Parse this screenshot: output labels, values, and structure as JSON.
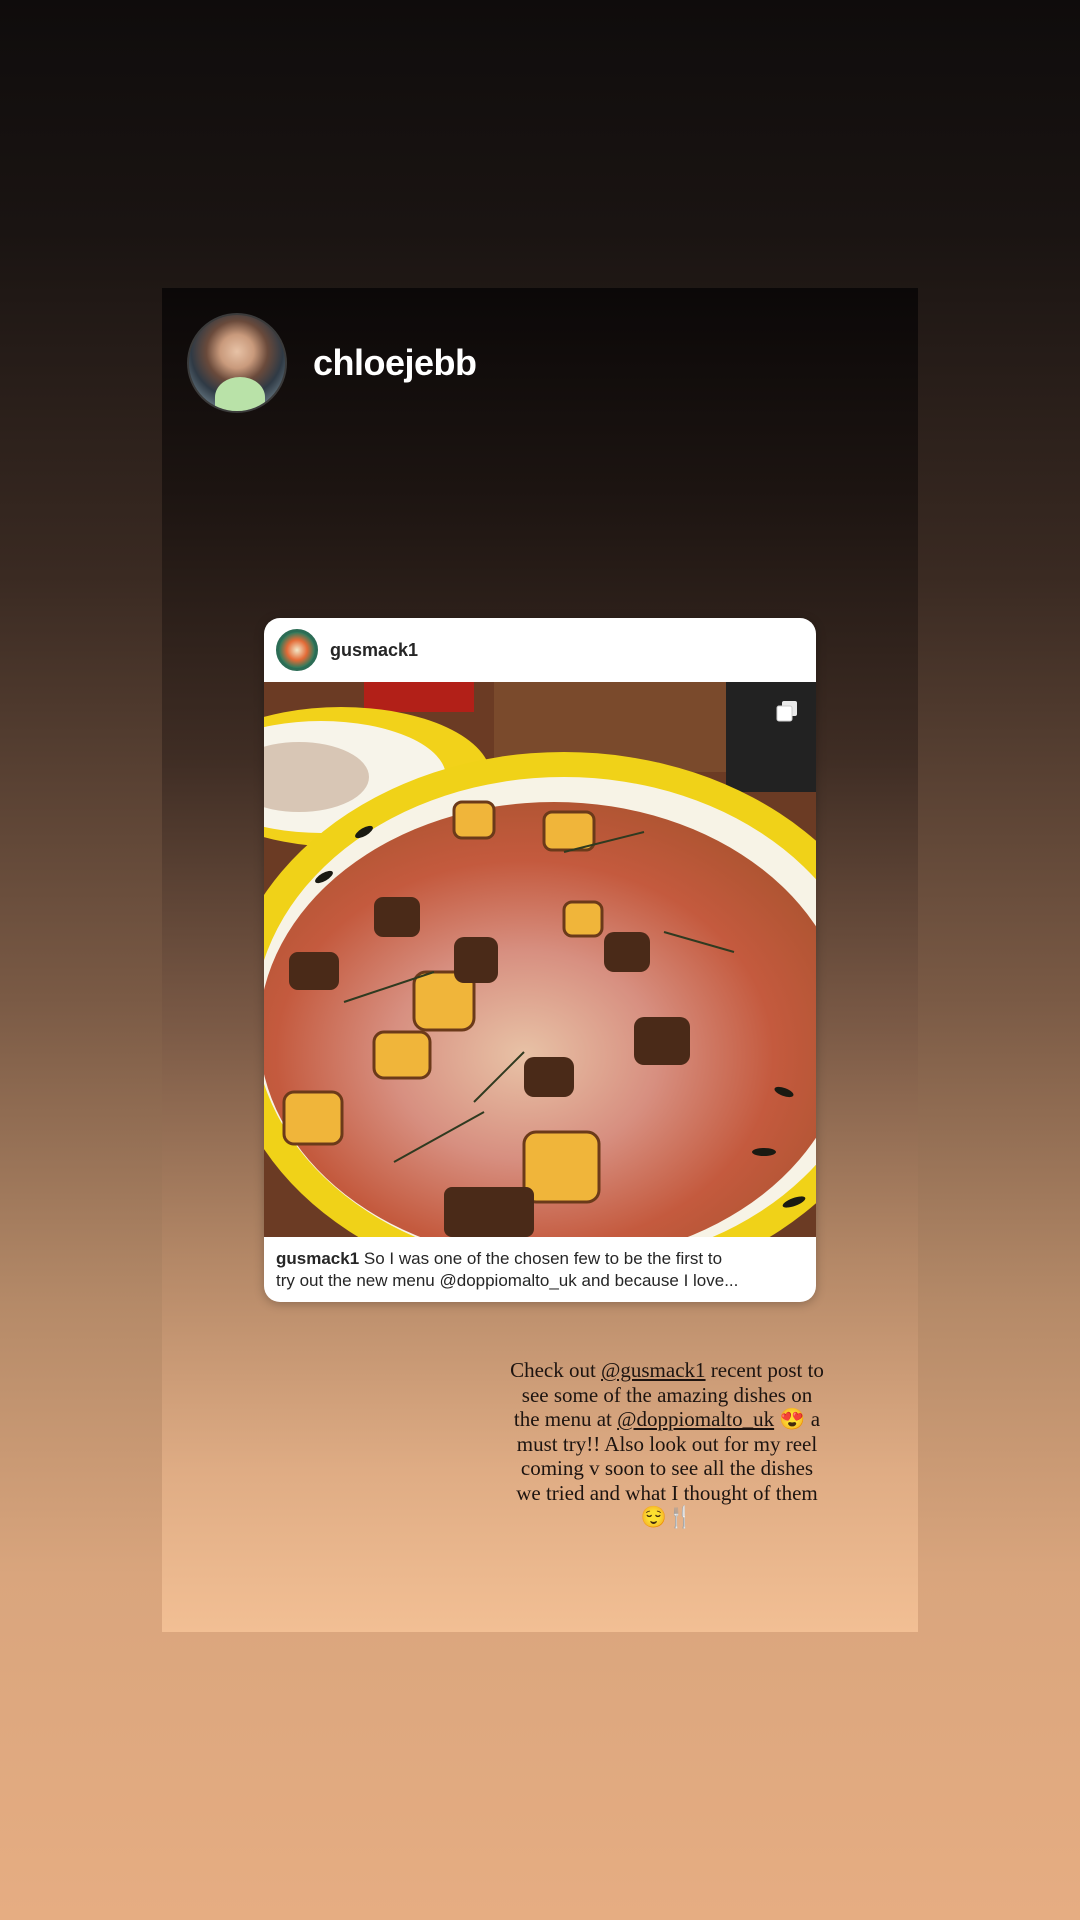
{
  "story": {
    "username": "chloejebb",
    "shared_post": {
      "username": "gusmack1",
      "caption_user": "gusmack1",
      "caption_line1": "So I was one of the chosen few to be the first to",
      "caption_line2": "try out the new menu @doppiomalto_uk and because I love...",
      "multi_icon": "carousel-icon"
    },
    "text": {
      "part1": "Check out ",
      "mention1": "@gusmack1",
      "part2": " recent post to see some of the amazing dishes on the menu at ",
      "mention2": "@doppiomalto_uk",
      "part3": " 😍 a must try!! Also look out for my reel coming v soon to see all the dishes we tried and what I thought of them 😌🍴"
    }
  }
}
